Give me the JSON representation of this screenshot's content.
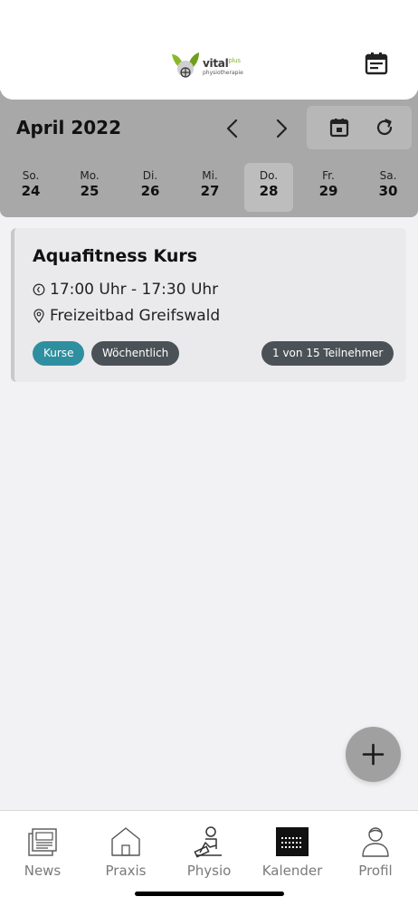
{
  "header": {
    "logo_text": "vital",
    "logo_plus": "plus",
    "logo_sub": "physiotherapie",
    "calendar_icon": "calendar-note-icon"
  },
  "toolbar": {
    "month_label": "April 2022",
    "prev_icon": "chevron-left-icon",
    "next_icon": "chevron-right-icon",
    "today_icon": "calendar-today-icon",
    "reload_icon": "reload-icon"
  },
  "days": [
    {
      "name": "So.",
      "num": "24",
      "selected": false
    },
    {
      "name": "Mo.",
      "num": "25",
      "selected": false
    },
    {
      "name": "Di.",
      "num": "26",
      "selected": false
    },
    {
      "name": "Mi.",
      "num": "27",
      "selected": false
    },
    {
      "name": "Do.",
      "num": "28",
      "selected": true
    },
    {
      "name": "Fr.",
      "num": "29",
      "selected": false
    },
    {
      "name": "Sa.",
      "num": "30",
      "selected": false
    }
  ],
  "event": {
    "title": "Aquafitness Kurs",
    "time": "17:00  Uhr - 17:30  Uhr",
    "location": "Freizeitbad Greifswald",
    "badge_category": "Kurse",
    "badge_frequency": "Wöchentlich",
    "badge_participants": "1 von 15 Teilnehmer",
    "colors": {
      "category": "#2e8fa0",
      "badge": "#4a5257"
    }
  },
  "fab": {
    "icon": "plus-icon"
  },
  "tabs": [
    {
      "label": "News",
      "icon": "newspaper-icon"
    },
    {
      "label": "Praxis",
      "icon": "house-icon"
    },
    {
      "label": "Physio",
      "icon": "physio-person-icon"
    },
    {
      "label": "Kalender",
      "icon": "calendar-grid-icon"
    },
    {
      "label": "Profil",
      "icon": "profile-person-icon"
    }
  ]
}
